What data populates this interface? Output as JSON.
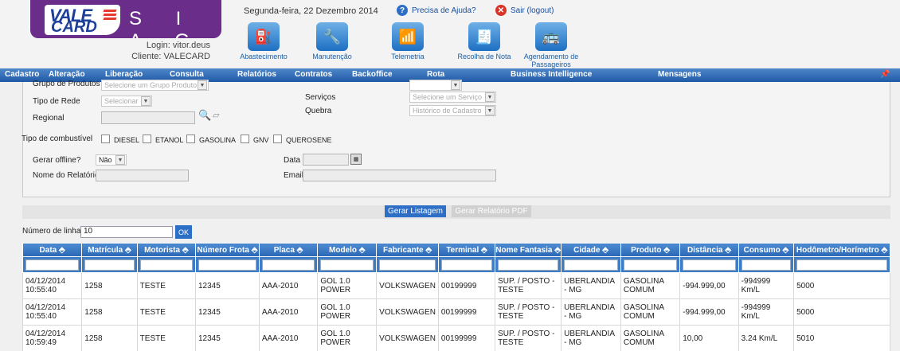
{
  "header": {
    "logo_vale": "VALE",
    "logo_card": "CARD",
    "logo_siag": "S I A G",
    "login_label": "Login: vitor.deus",
    "client_label": "Cliente: VALECARD",
    "date": "Segunda-feira, 22 Dezembro 2014",
    "help_link": "Precisa de Ajuda?",
    "logout_link": "Sair (logout)",
    "modules": [
      {
        "label": "Abastecimento",
        "icon": "fuel-pump-icon"
      },
      {
        "label": "Manutenção",
        "icon": "wrench-icon"
      },
      {
        "label": "Telemetria",
        "icon": "signal-icon"
      },
      {
        "label": "Recolha de Nota",
        "icon": "invoice-icon"
      },
      {
        "label": "Agendamento de Passageiros",
        "icon": "bus-icon"
      }
    ]
  },
  "nav": {
    "items": [
      "Cadastro",
      "Alteração",
      "Liberação",
      "Consulta",
      "Relatórios",
      "Contratos",
      "Backoffice",
      "Rota",
      "Business Intelligence",
      "Mensagens"
    ]
  },
  "form": {
    "grupo_label": "Grupo de Produtos",
    "grupo_value": "Selecione um Grupo Produto",
    "tipo_rede_label": "Tipo de Rede",
    "tipo_rede_value": "Selecionar",
    "regional_label": "Regional",
    "servicos_label": "Serviços",
    "servicos_value": "Selecione um Serviço",
    "quebra_label": "Quebra",
    "quebra_value": "Histórico de Cadastro",
    "combustivel_label": "Tipo de combustível",
    "combustiveis": [
      "DIESEL",
      "ETANOL",
      "GASOLINA",
      "GNV",
      "QUEROSENE"
    ],
    "offline_label": "Gerar offline?",
    "offline_value": "Não",
    "relatorio_label": "Nome do Relatório",
    "data_label": "Data",
    "email_label": "Email"
  },
  "buttons": {
    "gerar_listagem": "Gerar Listagem",
    "gerar_pdf": "Gerar Relatório PDF"
  },
  "table_controls": {
    "num_linhas_label": "Número de linhas:",
    "num_linhas_value": "10",
    "ok": "OK"
  },
  "table": {
    "columns": [
      "Data ⬘",
      "Matrícula ⬘",
      "Motorista ⬘",
      "Número Frota ⬘",
      "Placa ⬘",
      "Modelo ⬘",
      "Fabricante ⬘",
      "Terminal ⬘",
      "Nome Fantasia ⬘",
      "Cidade ⬘",
      "Produto ⬘",
      "Distância ⬘",
      "Consumo ⬘",
      "Hodômetro/Horímetro ⬘"
    ],
    "rows": [
      [
        "04/12/2014 10:55:40",
        "1258",
        "TESTE",
        "12345",
        "AAA-2010",
        "GOL 1.0 POWER",
        "VOLKSWAGEN",
        "00199999",
        "SUP. / POSTO - TESTE",
        "UBERLANDIA - MG",
        "GASOLINA COMUM",
        "-994.999,00",
        "-994999 Km/L",
        "5000"
      ],
      [
        "04/12/2014 10:55:40",
        "1258",
        "TESTE",
        "12345",
        "AAA-2010",
        "GOL 1.0 POWER",
        "VOLKSWAGEN",
        "00199999",
        "SUP. / POSTO - TESTE",
        "UBERLANDIA - MG",
        "GASOLINA COMUM",
        "-994.999,00",
        "-994999 Km/L",
        "5000"
      ],
      [
        "04/12/2014 10:59:49",
        "1258",
        "TESTE",
        "12345",
        "AAA-2010",
        "GOL 1.0 POWER",
        "VOLKSWAGEN",
        "00199999",
        "SUP. / POSTO - TESTE",
        "UBERLANDIA - MG",
        "GASOLINA COMUM",
        "10,00",
        "3.24 Km/L",
        "5010"
      ]
    ]
  },
  "colors": {
    "brand_purple": "#6a2d8a",
    "nav_blue": "#2a68b6",
    "header_blue": "#3f7cc6"
  }
}
